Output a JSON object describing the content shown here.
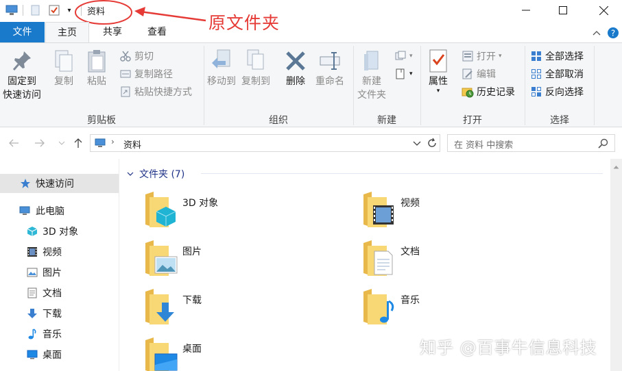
{
  "window": {
    "title": "资料",
    "minimize_glyph": "—",
    "maximize_glyph": "☐",
    "close_glyph": "✕"
  },
  "annotation": {
    "text": "原文件夹",
    "color": "#e53a35"
  },
  "tabs": {
    "file": "文件",
    "home": "主页",
    "share": "共享",
    "view": "查看"
  },
  "ribbon": {
    "clipboard": {
      "label": "剪贴板",
      "pin_line1": "固定到",
      "pin_line2": "快速访问",
      "copy": "复制",
      "paste": "粘贴",
      "cut": "剪切",
      "copy_path": "复制路径",
      "paste_shortcut": "粘贴快捷方式"
    },
    "organize": {
      "label": "组织",
      "move_to": "移动到",
      "copy_to": "复制到",
      "delete": "删除",
      "rename": "重命名"
    },
    "new": {
      "label": "新建",
      "new_folder_line1": "新建",
      "new_folder_line2": "文件夹"
    },
    "open": {
      "label": "打开",
      "properties": "属性",
      "open": "打开",
      "edit": "编辑",
      "history": "历史记录"
    },
    "select": {
      "label": "选择",
      "select_all": "全部选择",
      "select_none": "全部取消",
      "invert": "反向选择"
    }
  },
  "address": {
    "path": "资料",
    "search_placeholder": "在 资料 中搜索"
  },
  "nav": {
    "quick_access": "快速访问",
    "this_pc": "此电脑",
    "items": [
      "3D 对象",
      "视频",
      "图片",
      "文档",
      "下载",
      "音乐",
      "桌面"
    ]
  },
  "content": {
    "group_header": "文件夹 (7)",
    "folders": [
      "3D 对象",
      "视频",
      "图片",
      "文档",
      "下载",
      "音乐",
      "桌面"
    ]
  },
  "watermark": "知乎 @百事牛信息科技",
  "colors": {
    "accent": "#1979ca",
    "folder": "#f8d775",
    "folder_dark": "#e8b84a"
  }
}
